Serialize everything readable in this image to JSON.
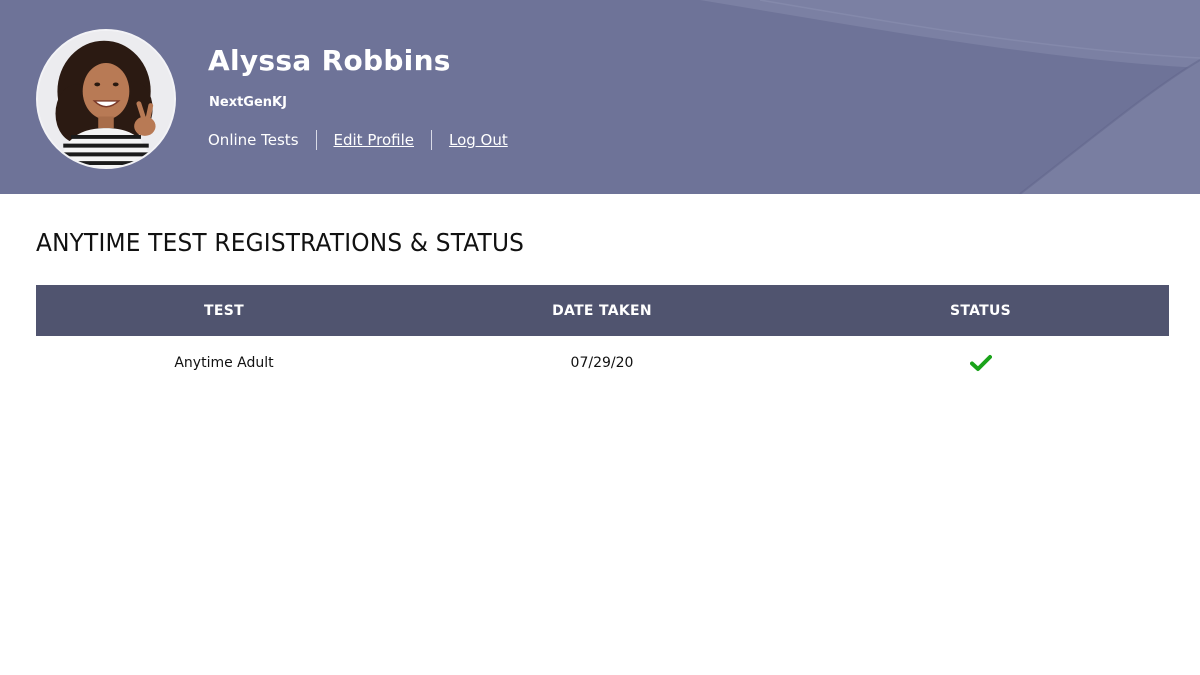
{
  "profile": {
    "name": "Alyssa Robbins",
    "username": "NextGenKJ"
  },
  "nav": {
    "online_tests": "Online Tests",
    "edit_profile": "Edit Profile",
    "log_out": "Log Out"
  },
  "section": {
    "title": "ANYTIME TEST REGISTRATIONS & STATUS"
  },
  "table": {
    "headers": {
      "test": "TEST",
      "date_taken": "DATE TAKEN",
      "status": "STATUS"
    },
    "rows": [
      {
        "test": "Anytime Adult",
        "date_taken": "07/29/20",
        "status_icon": "checkmark-icon"
      }
    ]
  },
  "colors": {
    "header_bg": "#6e7398",
    "table_header_bg": "#50546f",
    "status_complete": "#1aa31a"
  }
}
